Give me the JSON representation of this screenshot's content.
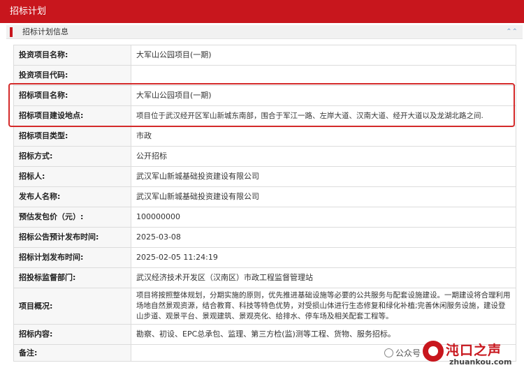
{
  "header": {
    "title": "招标计划"
  },
  "section": {
    "label": "招标计划信息",
    "collapse_icon": "double-chevron-up-icon"
  },
  "rows": [
    {
      "key": "投资项目名称:",
      "value": "大军山公园项目(一期)"
    },
    {
      "key": "投资项目代码:",
      "value": ""
    },
    {
      "key": "招标项目名称:",
      "value": "大军山公园项目(一期)"
    },
    {
      "key": "招标项目建设地点:",
      "value": "项目位于武汉经开区军山新城东南部，围合于军江一路、左岸大道、汉南大道、经开大道以及龙湖北路之间."
    },
    {
      "key": "招标项目类型:",
      "value": "市政"
    },
    {
      "key": "招标方式:",
      "value": "公开招标"
    },
    {
      "key": "招标人:",
      "value": "武汉军山新城基础投资建设有限公司"
    },
    {
      "key": "发布人名称:",
      "value": "武汉军山新城基础投资建设有限公司"
    },
    {
      "key": "预估发包价（元）:",
      "value": "100000000"
    },
    {
      "key": "招标公告预计发布时间:",
      "value": "2025-03-08"
    },
    {
      "key": "招标计划发布时间:",
      "value": "2025-02-05 11:24:19"
    },
    {
      "key": "招投标监督部门:",
      "value": "武汉经济技术开发区（汉南区）市政工程监督管理站"
    },
    {
      "key": "项目概况:",
      "value": "项目将按照整体规划，分期实施的原则，优先推进基础设施等必要的公共服务与配套设施建设。一期建设将合理利用场地自然景观资源，结合教育、科技等特色优势，对受损山体进行生态修复和绿化补植;完善休闲服务设施，建设登山步道、观景平台、景观建筑、景观亮化、给排水、停车场及相关配套工程等。"
    },
    {
      "key": "招标内容:",
      "value": "勘察、初设、EPC总承包、监理、第三方检(监)测等工程、货物、服务招标。"
    },
    {
      "key": "备注:",
      "value": ""
    }
  ],
  "watermark": {
    "wechat_text": "公众号",
    "brand": "沌口之声",
    "site": "zhuankou.com"
  },
  "colors": {
    "accent": "#c8161d",
    "highlight_border": "#d42a2a"
  }
}
